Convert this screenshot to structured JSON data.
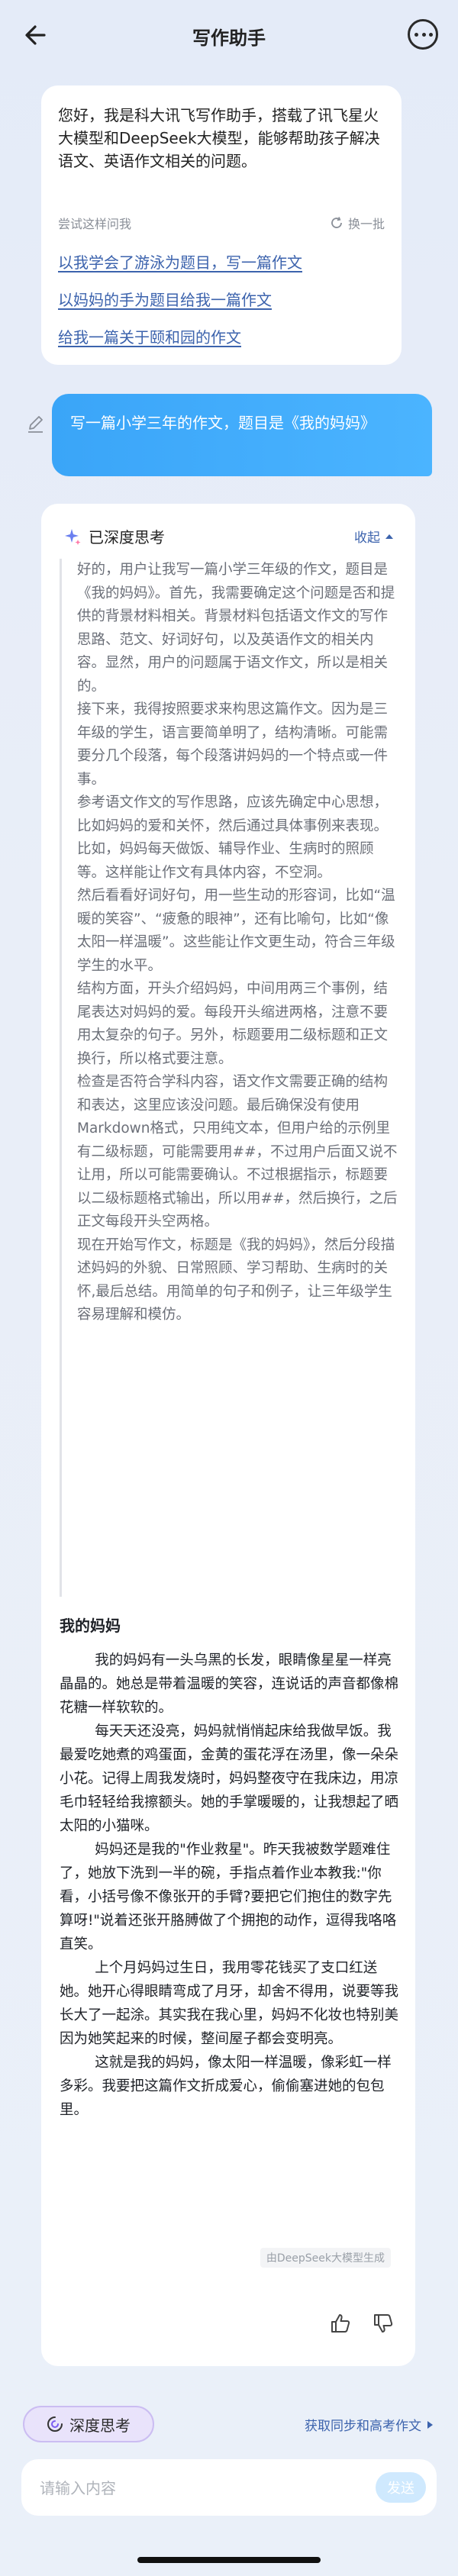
{
  "header": {
    "title": "写作助手"
  },
  "welcome": {
    "intro": "您好，我是科大讯飞写作助手，搭载了讯飞星火大模型和DeepSeek大模型，能够帮助孩子解决语文、英语作文相关的问题。",
    "try_label": "尝试这样问我",
    "refresh_label": "换一批",
    "suggestions": [
      "以我学会了游泳为题目，写一篇作文",
      "以妈妈的手为题目给我一篇作文",
      "给我一篇关于颐和园的作文"
    ]
  },
  "user_message": "写一篇小学三年的作文，题目是《我的妈妈》",
  "thinking": {
    "label": "已深度思考",
    "fold_label": "收起",
    "paragraphs": [
      "好的，用户让我写一篇小学三年级的作文，题目是《我的妈妈》。首先，我需要确定这个问题是否和提供的背景材料相关。背景材料包括语文作文的写作思路、范文、好词好句，以及英语作文的相关内容。显然，用户的问题属于语文作文，所以是相关的。",
      "接下来，我得按照要求来构思这篇作文。因为是三年级的学生，语言要简单明了，结构清晰。可能需要分几个段落，每个段落讲妈妈的一个特点或一件事。",
      "参考语文作文的写作思路，应该先确定中心思想，比如妈妈的爱和关怀，然后通过具体事例来表现。比如，妈妈每天做饭、辅导作业、生病时的照顾等。这样能让作文有具体内容，不空洞。",
      "然后看看好词好句，用一些生动的形容词，比如“温暖的笑容”、“疲惫的眼神”，还有比喻句，比如“像太阳一样温暖”。这些能让作文更生动，符合三年级学生的水平。",
      "结构方面，开头介绍妈妈，中间用两三个事例，结尾表达对妈妈的爱。每段开头缩进两格，注意不要用太复杂的句子。另外，标题要用二级标题和正文换行，所以格式要注意。",
      "检查是否符合学科内容，语文作文需要正确的结构和表达，这里应该没问题。最后确保没有使用Markdown格式，只用纯文本，但用户给的示例里有二级标题，可能需要用##，不过用户后面又说不让用，所以可能需要确认。不过根据指示，标题要以二级标题格式输出，所以用##，然后换行，之后正文每段开头空两格。",
      "现在开始写作文，标题是《我的妈妈》，然后分段描述妈妈的外貌、日常照顾、学习帮助、生病时的关怀,最后总结。用简单的句子和例子，让三年级学生容易理解和模仿。"
    ]
  },
  "answer": {
    "title": "我的妈妈",
    "paragraphs": [
      "我的妈妈有一头乌黑的长发，眼睛像星星一样亮晶晶的。她总是带着温暖的笑容，连说话的声音都像棉花糖一样软软的。",
      "每天天还没亮，妈妈就悄悄起床给我做早饭。我最爱吃她煮的鸡蛋面，金黄的蛋花浮在汤里，像一朵朵小花。记得上周我发烧时，妈妈整夜守在我床边，用凉毛巾轻轻给我擦额头。她的手掌暖暖的，让我想起了晒太阳的小猫咪。",
      "妈妈还是我的\"作业救星\"。昨天我被数学题难住了，她放下洗到一半的碗，手指点着作业本教我:\"你看，小括号像不像张开的手臂?要把它们抱住的数字先算呀!\"说着还张开胳膊做了个拥抱的动作，逗得我咯咯直笑。",
      "上个月妈妈过生日，我用零花钱买了支口红送她。她开心得眼睛弯成了月牙，却舍不得用，说要等我长大了一起涂。其实我在我心里，妈妈不化妆也特别美因为她笑起来的时候，整间屋子都会变明亮。",
      "这就是我的妈妈，像太阳一样温暖，像彩虹一样多彩。我要把这篇作文折成爱心，偷偷塞进她的包包里。"
    ],
    "generated_note": "由DeepSeek大模型生成"
  },
  "bottom": {
    "deep_think_label": "深度思考",
    "sync_label": "获取同步和高考作文",
    "input_placeholder": "请输入内容",
    "send_label": "发送"
  },
  "colors": {
    "accent": "#3c63ad",
    "bubble": "#41acfb",
    "send_disabled": "#cfe9fe"
  }
}
